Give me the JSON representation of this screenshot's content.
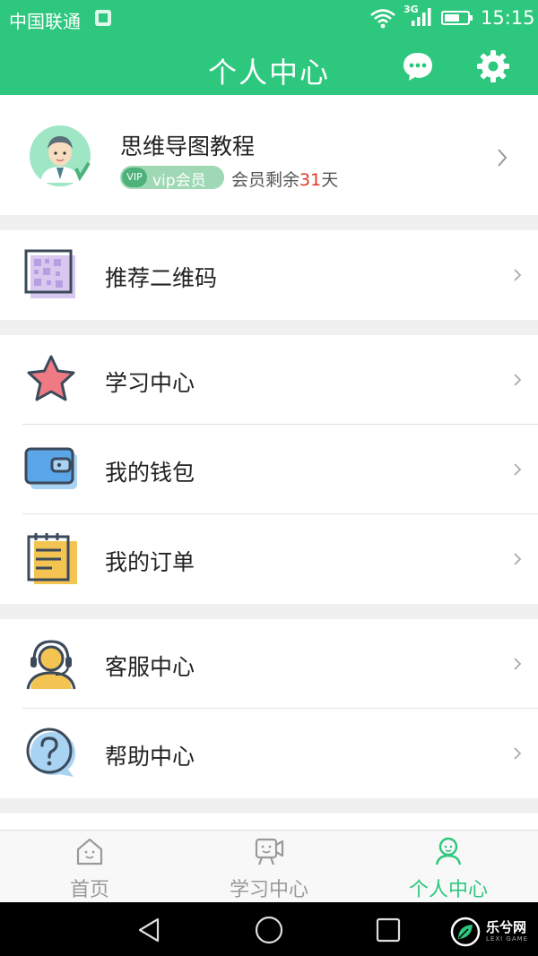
{
  "status_bar": {
    "carrier": "中国联通",
    "network": "3G",
    "time": "15:15"
  },
  "header": {
    "title": "个人中心",
    "message_icon": "chat-bubble-icon",
    "settings_icon": "gear-icon"
  },
  "profile": {
    "name": "思维导图教程",
    "vip_tag": "VIP",
    "vip_label": "vip会员",
    "days_prefix": "会员剩余",
    "days_value": "31",
    "days_suffix": "天"
  },
  "menu": {
    "qrcode": {
      "label": "推荐二维码",
      "icon": "qr-code-icon"
    },
    "learning": {
      "label": "学习中心",
      "icon": "star-icon"
    },
    "wallet": {
      "label": "我的钱包",
      "icon": "wallet-icon"
    },
    "orders": {
      "label": "我的订单",
      "icon": "notepad-icon"
    },
    "service": {
      "label": "客服中心",
      "icon": "headset-agent-icon"
    },
    "help": {
      "label": "帮助中心",
      "icon": "question-bubble-icon"
    }
  },
  "tabs": [
    {
      "label": "首页",
      "icon": "home-icon",
      "active": false
    },
    {
      "label": "学习中心",
      "icon": "video-study-icon",
      "active": false
    },
    {
      "label": "个人中心",
      "icon": "person-icon",
      "active": true
    }
  ],
  "watermark": {
    "text": "乐兮网",
    "sub": "LEXI GAME"
  },
  "colors": {
    "primary": "#2ec77e",
    "highlight": "#e0392b",
    "background": "#f0f0f0"
  }
}
